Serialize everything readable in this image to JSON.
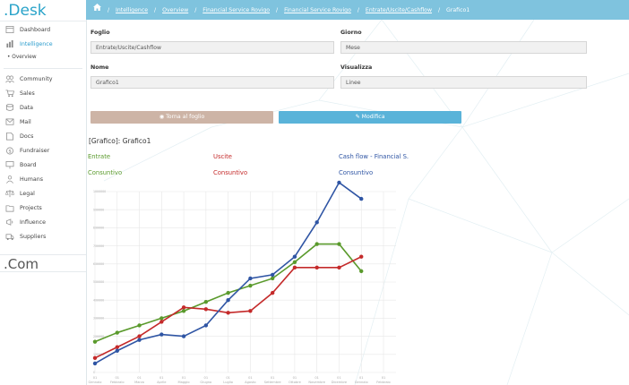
{
  "app": {
    "logo_top": ".Desk",
    "logo_bottom": ".Com"
  },
  "sidebar": {
    "items": [
      {
        "label": "Dashboard",
        "icon": "dashboard-icon"
      },
      {
        "label": "Intelligence",
        "icon": "intelligence-icon",
        "active": true
      },
      {
        "label": "Community",
        "icon": "community-icon"
      },
      {
        "label": "Sales",
        "icon": "sales-icon"
      },
      {
        "label": "Data",
        "icon": "data-icon"
      },
      {
        "label": "Mail",
        "icon": "mail-icon"
      },
      {
        "label": "Docs",
        "icon": "docs-icon"
      },
      {
        "label": "Fundraiser",
        "icon": "fundraiser-icon"
      },
      {
        "label": "Board",
        "icon": "board-icon"
      },
      {
        "label": "Humans",
        "icon": "humans-icon"
      },
      {
        "label": "Legal",
        "icon": "legal-icon"
      },
      {
        "label": "Projects",
        "icon": "projects-icon"
      },
      {
        "label": "Influence",
        "icon": "influence-icon"
      },
      {
        "label": "Suppliers",
        "icon": "suppliers-icon"
      }
    ],
    "sub_item": "Overview"
  },
  "breadcrumb": [
    "Intelligence",
    "Overview",
    "Financial Service Rovigo",
    "Financial Service Rovigo",
    "Entrate/Uscite/Cashflow",
    "Grafico1"
  ],
  "form": {
    "foglio_label": "Foglio",
    "foglio_value": "Entrate/Uscite/Cashflow",
    "giorno_label": "Giorno",
    "giorno_value": "Mese",
    "nome_label": "Nome",
    "nome_value": "Grafico1",
    "visualizza_label": "Visualizza",
    "visualizza_value": "Linee"
  },
  "buttons": {
    "back": "Torna al foglio",
    "edit": "Modifica"
  },
  "chart_heading": "[Grafico]: Grafico1",
  "legend": [
    {
      "name": "Entrate",
      "sub": "Consuntivo",
      "color": "#5a9a2c"
    },
    {
      "name": "Uscite",
      "sub": "Consuntivo",
      "color": "#c42a2a"
    },
    {
      "name": "Cash flow - Financial S.",
      "sub": "Consuntivo",
      "color": "#2f55a4"
    }
  ],
  "colors": {
    "header": "#7fc3de",
    "accent": "#2a9ccd",
    "back_button": "#cdb4a6",
    "edit_button": "#5ab3d9"
  },
  "chart_data": {
    "type": "line",
    "x": [
      "Gennaio",
      "Febbraio",
      "Marzo",
      "Aprile",
      "Maggio",
      "Giugno",
      "Luglio",
      "Agosto",
      "Settembre",
      "Ottobre",
      "Novembre",
      "Dicembre",
      "Gennaio",
      "Febbraio"
    ],
    "x_prefix": "01",
    "ylim": [
      0,
      1000000
    ],
    "yticks": [
      0,
      100000,
      200000,
      300000,
      400000,
      500000,
      600000,
      700000,
      800000,
      900000,
      1000000
    ],
    "grid": true,
    "series": [
      {
        "name": "Entrate",
        "color": "#5a9a2c",
        "values": [
          170000,
          220000,
          260000,
          300000,
          340000,
          390000,
          440000,
          480000,
          520000,
          610000,
          710000,
          710000,
          560000
        ]
      },
      {
        "name": "Uscite",
        "color": "#c42a2a",
        "values": [
          80000,
          140000,
          200000,
          280000,
          360000,
          350000,
          330000,
          340000,
          440000,
          580000,
          580000,
          580000,
          640000
        ]
      },
      {
        "name": "Cash flow - Financial S.",
        "color": "#2f55a4",
        "values": [
          50000,
          120000,
          180000,
          210000,
          200000,
          260000,
          400000,
          520000,
          540000,
          640000,
          830000,
          1050000,
          960000
        ]
      }
    ]
  }
}
